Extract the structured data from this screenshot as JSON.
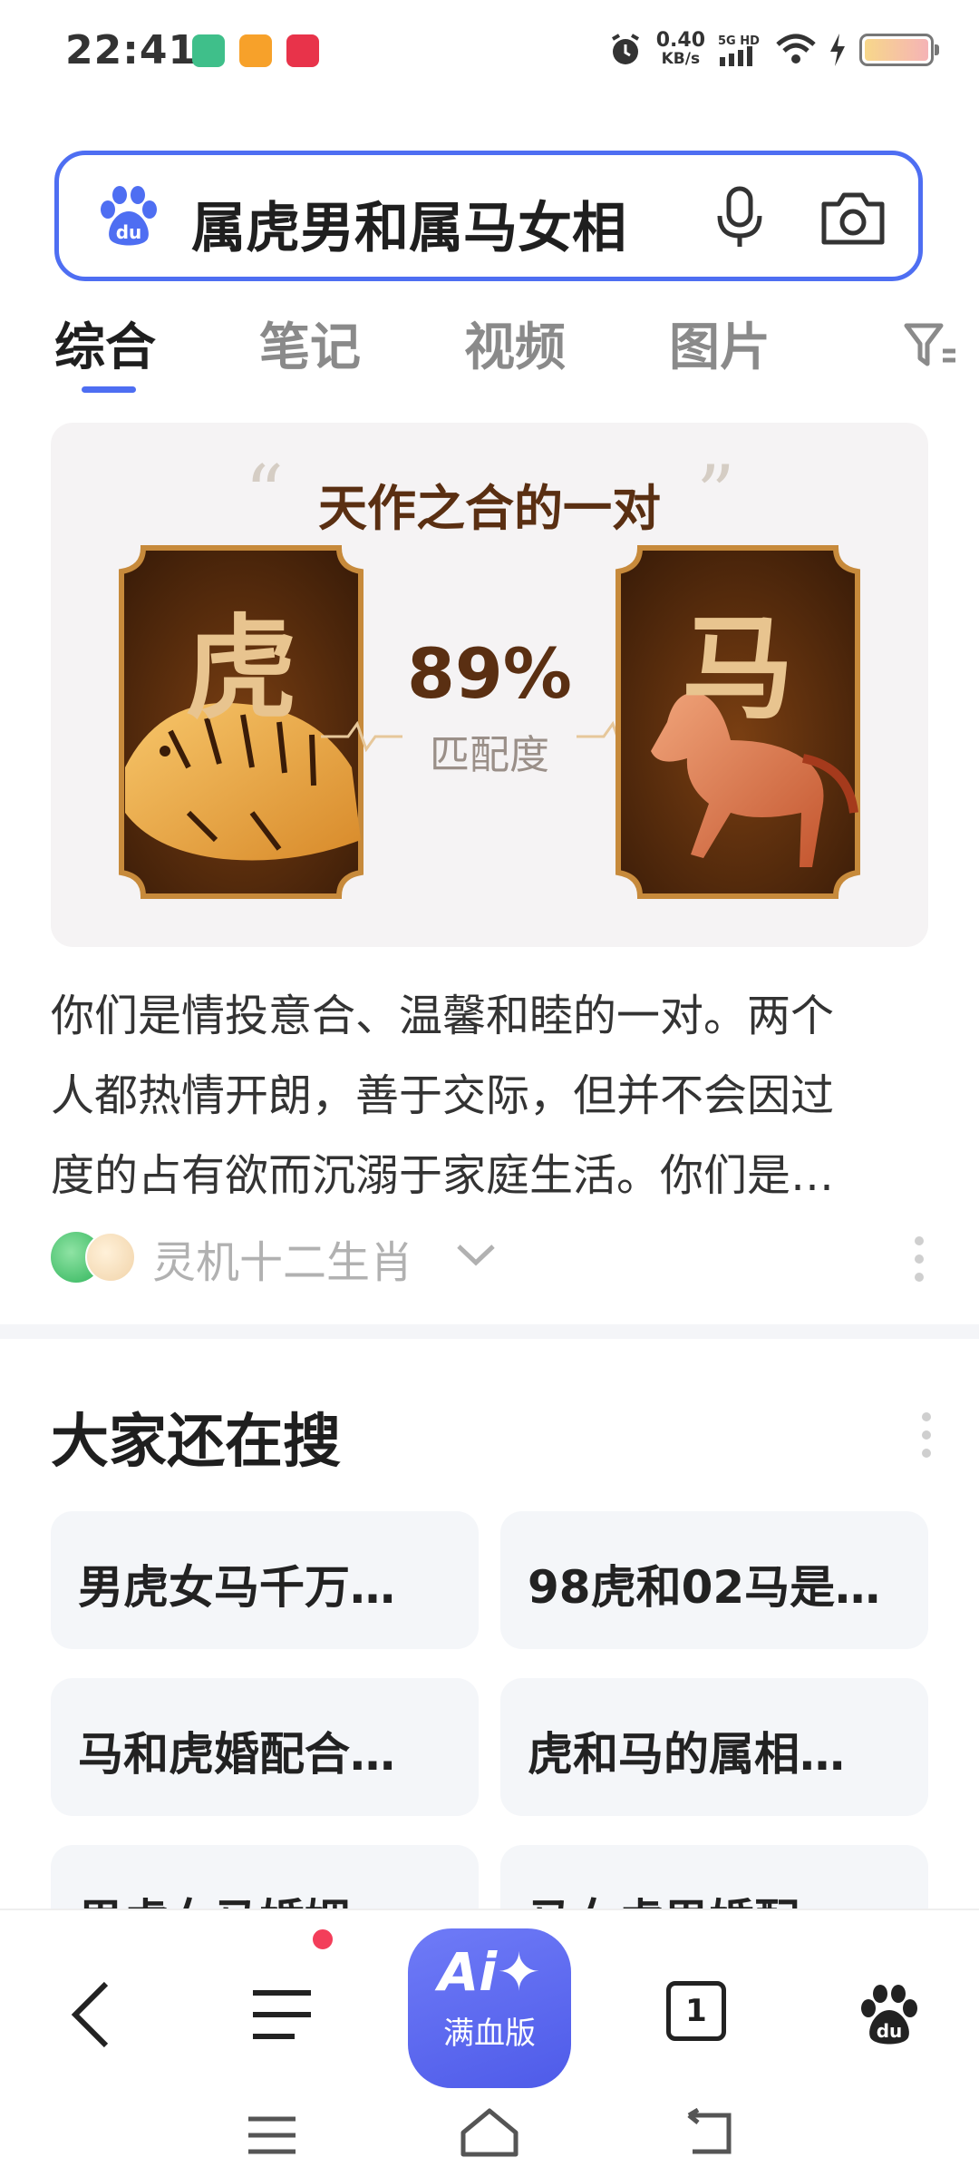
{
  "status_bar": {
    "time": "22:41",
    "net_speed_value": "0.40",
    "net_speed_unit": "KB/s",
    "network": "5G HD"
  },
  "search": {
    "query": "属虎男和属马女相"
  },
  "tabs": [
    {
      "label": "综合"
    },
    {
      "label": "笔记"
    },
    {
      "label": "视频"
    },
    {
      "label": "图片"
    }
  ],
  "result": {
    "hero_title": "天作之合的一对",
    "left_zodiac": "虎",
    "right_zodiac": "马",
    "match_value": "89%",
    "match_label": "匹配度",
    "summary_lines": [
      "你们是情投意合、温馨和睦的一对。两个",
      "人都热情开朗，善于交际，但并不会因过",
      "度的占有欲而沉溺于家庭生活。你们是…"
    ],
    "source_name": "灵机十二生肖"
  },
  "related": {
    "title": "大家还在搜",
    "items": [
      "男虎女马千万…",
      "98虎和02马是…",
      "马和虎婚配合…",
      "虎和马的属相…",
      "男虎女马婚姻…",
      "马女虎男婚配…"
    ]
  },
  "bottom_nav": {
    "ai_logo": "Ai✦",
    "ai_label": "满血版",
    "tab_count": "1"
  },
  "colors": {
    "accent": "#4e6ef2",
    "hero_brown": "#5a2f12",
    "ai_button": "#5863ef",
    "badge_red": "#f33e5a"
  }
}
